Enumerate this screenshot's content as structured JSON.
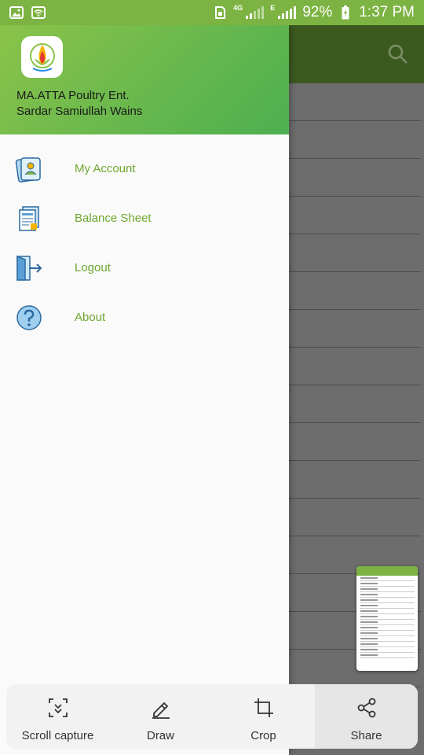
{
  "status_bar": {
    "network": "4G",
    "network2": "E",
    "battery": "92%",
    "time": "1:37 PM",
    "icons": [
      "image-icon",
      "wifi-icon",
      "sim-icon",
      "signal-icon",
      "signal-icon",
      "battery-icon"
    ]
  },
  "drawer": {
    "business_name": "MA.ATTA Poultry Ent.",
    "user_name": "Sardar Samiullah Wains",
    "menu": [
      {
        "label": "My Account",
        "icon": "id-card-icon"
      },
      {
        "label": "Balance Sheet",
        "icon": "document-icon"
      },
      {
        "label": "Logout",
        "icon": "logout-door-icon"
      },
      {
        "label": "About",
        "icon": "help-icon"
      }
    ]
  },
  "actions": [
    {
      "label": "Scroll capture",
      "icon": "scroll-capture-icon"
    },
    {
      "label": "Draw",
      "icon": "pencil-icon"
    },
    {
      "label": "Crop",
      "icon": "crop-icon"
    },
    {
      "label": "Share",
      "icon": "share-icon"
    }
  ],
  "colors": {
    "accent": "#7cb342",
    "menu_text": "#6ea82f",
    "toolbar_dark": "#3b5a1f"
  }
}
